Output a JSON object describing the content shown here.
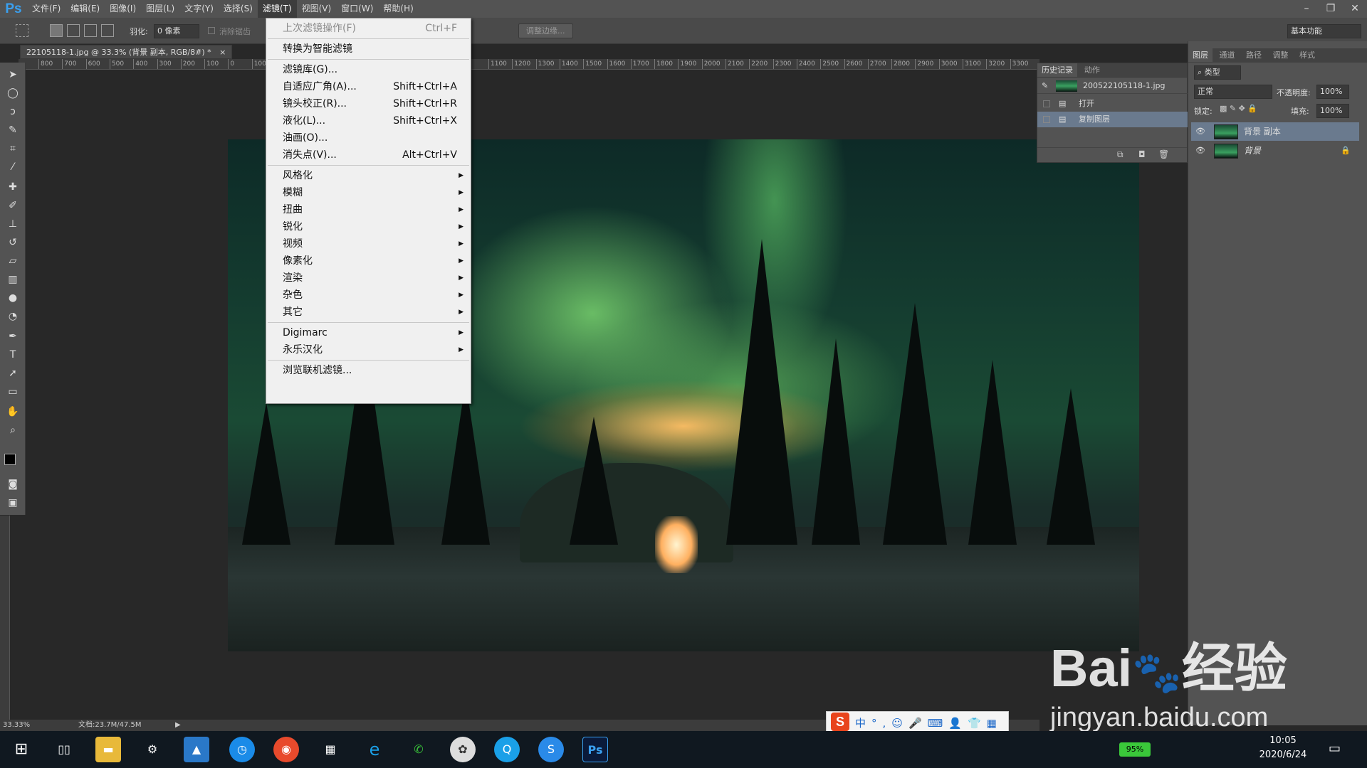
{
  "app": {
    "logo": "Ps"
  },
  "menubar": {
    "items": [
      "文件(F)",
      "编辑(E)",
      "图像(I)",
      "图层(L)",
      "文字(Y)",
      "选择(S)",
      "滤镜(T)",
      "视图(V)",
      "窗口(W)",
      "帮助(H)"
    ],
    "active_index": 6,
    "window_controls": [
      "minimize-icon",
      "restore-icon",
      "close-icon"
    ]
  },
  "options": {
    "feather_label": "羽化:",
    "feather_value": "0 像素",
    "antialias_label": "消除锯齿",
    "refine_edge": "调整边缘...",
    "workspace": "基本功能"
  },
  "document": {
    "tab_title": "22105118-1.jpg @ 33.3% (背景 副本, RGB/8#) *",
    "ruler_ticks": [
      "800",
      "700",
      "600",
      "500",
      "400",
      "300",
      "200",
      "100",
      "0",
      "100",
      "1100",
      "1200",
      "1300",
      "1400",
      "1500",
      "1600",
      "1700",
      "1800",
      "1900",
      "2000",
      "2100",
      "2200",
      "2300",
      "2400",
      "2500",
      "2600",
      "2700",
      "2800",
      "2900",
      "3000",
      "3100",
      "3200",
      "3300"
    ]
  },
  "filter_menu": {
    "items": [
      {
        "label": "上次滤镜操作(F)",
        "shortcut": "Ctrl+F",
        "disabled": true
      },
      {
        "sep": true
      },
      {
        "label": "转换为智能滤镜"
      },
      {
        "sep": true
      },
      {
        "label": "滤镜库(G)..."
      },
      {
        "label": "自适应广角(A)...",
        "shortcut": "Shift+Ctrl+A"
      },
      {
        "label": "镜头校正(R)...",
        "shortcut": "Shift+Ctrl+R"
      },
      {
        "label": "液化(L)...",
        "shortcut": "Shift+Ctrl+X"
      },
      {
        "label": "油画(O)..."
      },
      {
        "label": "消失点(V)...",
        "shortcut": "Alt+Ctrl+V"
      },
      {
        "sep": true
      },
      {
        "label": "风格化",
        "submenu": true
      },
      {
        "label": "模糊",
        "submenu": true
      },
      {
        "label": "扭曲",
        "submenu": true
      },
      {
        "label": "锐化",
        "submenu": true
      },
      {
        "label": "视频",
        "submenu": true
      },
      {
        "label": "像素化",
        "submenu": true
      },
      {
        "label": "渲染",
        "submenu": true
      },
      {
        "label": "杂色",
        "submenu": true
      },
      {
        "label": "其它",
        "submenu": true
      },
      {
        "sep": true
      },
      {
        "label": "Digimarc",
        "submenu": true
      },
      {
        "label": "永乐汉化",
        "submenu": true
      },
      {
        "sep": true
      },
      {
        "label": "浏览联机滤镜..."
      }
    ]
  },
  "history_panel": {
    "tabs": [
      "历史记录",
      "动作"
    ],
    "snapshot": "200522105118-1.jpg",
    "entries": [
      "打开",
      "复制图层"
    ]
  },
  "layers_panel": {
    "tabs": [
      "图层",
      "通道",
      "路径",
      "调整",
      "样式"
    ],
    "filter": "类型",
    "blend_mode": "正常",
    "opacity_label": "不透明度:",
    "opacity": "100%",
    "lock_label": "锁定:",
    "fill_label": "填充:",
    "fill": "100%",
    "layers": [
      {
        "name": "背景 副本",
        "selected": true
      },
      {
        "name": "背景",
        "locked": true
      }
    ]
  },
  "status": {
    "zoom": "33.33%",
    "doc": "文档:23.7M/47.5M"
  },
  "ime": {
    "items": [
      "中",
      "°,",
      "☺",
      "🎤",
      "⌨",
      "👤",
      "👕",
      "▦"
    ]
  },
  "taskbar": {
    "battery": "95%",
    "time": "10:05",
    "date": "2020/6/24"
  },
  "watermark": {
    "brand": "Bai",
    "brand2": "经验",
    "url": "jingyan.baidu.com"
  }
}
